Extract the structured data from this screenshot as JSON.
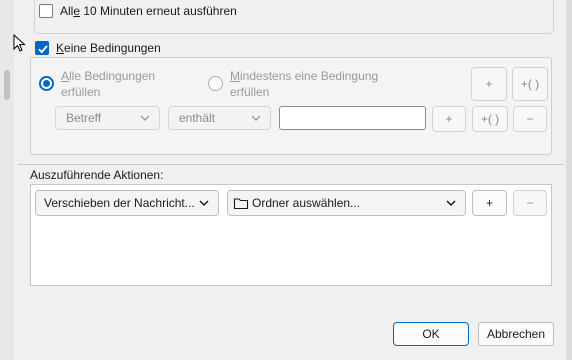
{
  "schedule": {
    "rerun_label_pre": "All",
    "rerun_label_accel": "e",
    "rerun_label_post": " 10 Minuten erneut ausführen",
    "rerun_checked": false
  },
  "conditions": {
    "no_conditions_accel": "K",
    "no_conditions_rest": "eine Bedingungen",
    "no_conditions_checked": true,
    "match_all_accel": "A",
    "match_all_line1": "lle Bedingungen",
    "match_all_line2": "erfüllen",
    "match_any_accel": "M",
    "match_any_line1": "indestens eine Bedingung",
    "match_any_line2": "erfüllen",
    "group_add_label": "+",
    "group_add_paren_label": "+( )",
    "field_select": "Betreff",
    "operator_select": "enthält",
    "value_input": "",
    "row_add_label": "+",
    "row_add_paren_label": "+( )",
    "row_remove_label": "−"
  },
  "actions": {
    "heading": "Auszuführende Aktionen:",
    "action_select": "Verschieben der Nachricht...",
    "folder_select": "Ordner auswählen...",
    "add_label": "+",
    "remove_label": "−"
  },
  "footer": {
    "ok_label": "OK",
    "cancel_label": "Abbrechen"
  },
  "colors": {
    "accent": "#0067c0"
  }
}
